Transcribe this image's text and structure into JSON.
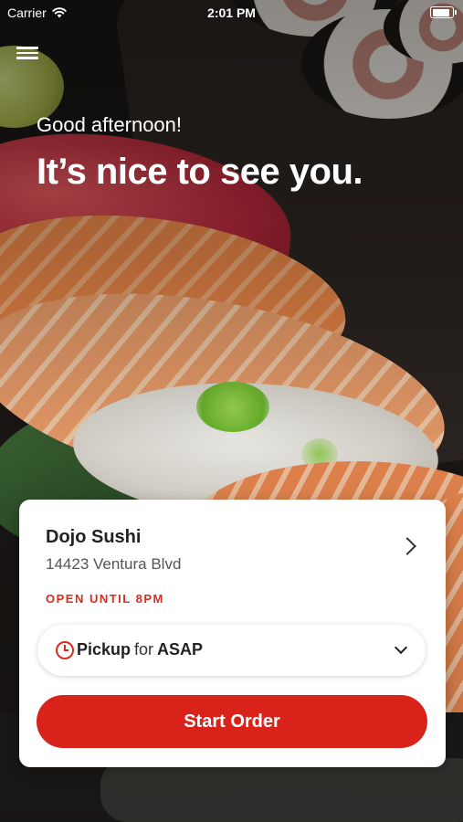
{
  "status_bar": {
    "carrier": "Carrier",
    "time": "2:01 PM",
    "battery_level": 1.0
  },
  "greeting": {
    "subtitle": "Good afternoon!",
    "title": "It’s nice to see you."
  },
  "store": {
    "name": "Dojo Sushi",
    "address": "14423 Ventura Blvd",
    "hours": "OPEN UNTIL 8PM"
  },
  "order_mode": {
    "mode": "Pickup",
    "connector": "for",
    "time": "ASAP"
  },
  "actions": {
    "start_order_label": "Start Order"
  },
  "colors": {
    "accent": "#d9231a",
    "hours_text": "#d92c1e",
    "card_background": "#ffffff"
  },
  "icons": [
    "menu-icon",
    "wifi-icon",
    "battery-icon",
    "chevron-right-icon",
    "clock-icon",
    "chevron-down-icon"
  ]
}
